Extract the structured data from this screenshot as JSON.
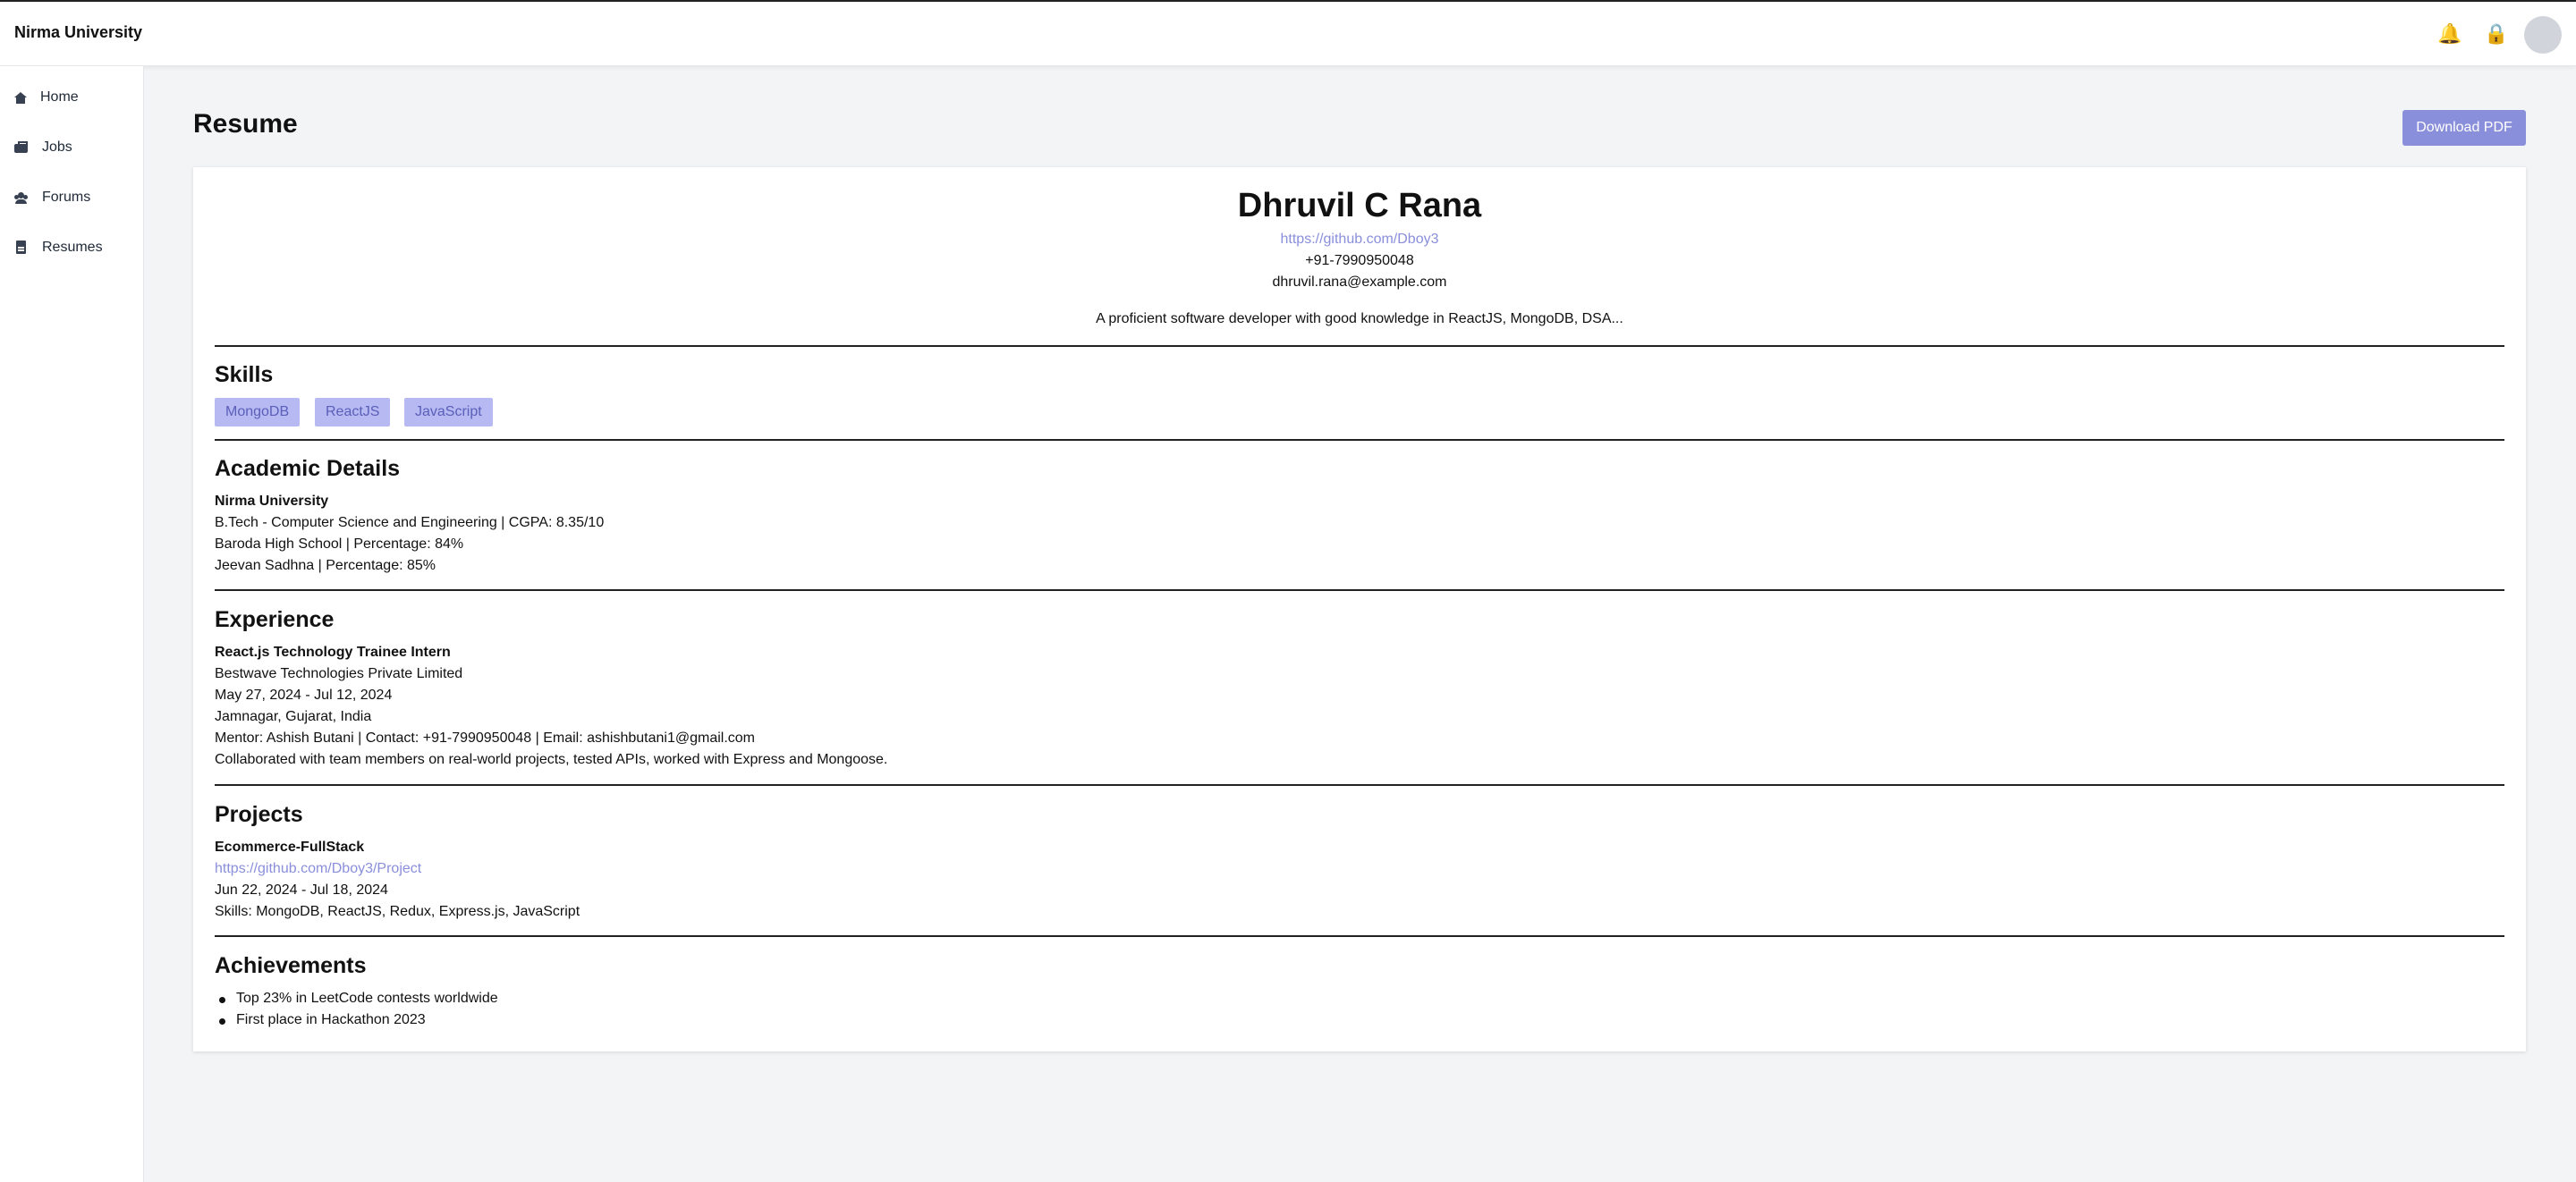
{
  "navbar": {
    "brand": "Nirma University",
    "icons": [
      "bell-icon",
      "lock-icon",
      "avatar"
    ]
  },
  "sidebar": {
    "items": [
      {
        "label": "Home",
        "icon": "home-icon"
      },
      {
        "label": "Jobs",
        "icon": "briefcase-icon"
      },
      {
        "label": "Forums",
        "icon": "users-icon"
      },
      {
        "label": "Resumes",
        "icon": "file-icon"
      }
    ]
  },
  "main": {
    "title": "Resume",
    "download_label": "Download PDF"
  },
  "resume": {
    "name": "Dhruvil C Rana",
    "github": "https://github.com/Dboy3",
    "phone": "+91-7990950048",
    "email": "dhruvil.rana@example.com",
    "summary": "A proficient software developer with good knowledge in ReactJS, MongoDB, DSA...",
    "skills_title": "Skills",
    "skills": [
      "MongoDB",
      "ReactJS",
      "JavaScript"
    ],
    "academic_title": "Academic Details",
    "academic": {
      "institution": "Nirma University",
      "lines": [
        "B.Tech - Computer Science and Engineering | CGPA: 8.35/10",
        "Baroda High School | Percentage: 84%",
        "Jeevan Sadhna | Percentage: 85%"
      ]
    },
    "experience_title": "Experience",
    "experience": {
      "role": "React.js Technology Trainee Intern",
      "company": "Bestwave Technologies Private Limited",
      "dates": "May 27, 2024 - Jul 12, 2024",
      "location": "Jamnagar, Gujarat, India",
      "mentor": "Mentor: Ashish Butani | Contact: +91-7990950048 | Email: ashishbutani1@gmail.com",
      "description": "Collaborated with team members on real-world projects, tested APIs, worked with Express and Mongoose."
    },
    "projects_title": "Projects",
    "project": {
      "name": "Ecommerce-FullStack",
      "link": "https://github.com/Dboy3/Project",
      "dates": "Jun 22, 2024 - Jul 18, 2024",
      "skills": "Skills: MongoDB, ReactJS, Redux, Express.js, JavaScript"
    },
    "achievements_title": "Achievements",
    "achievements": [
      "Top 23% in LeetCode contests worldwide",
      "First place in Hackathon 2023"
    ]
  },
  "colors": {
    "accent": "#8a8fdb",
    "chip_bg": "#b7b9f3",
    "page_bg": "#f3f4f6"
  }
}
